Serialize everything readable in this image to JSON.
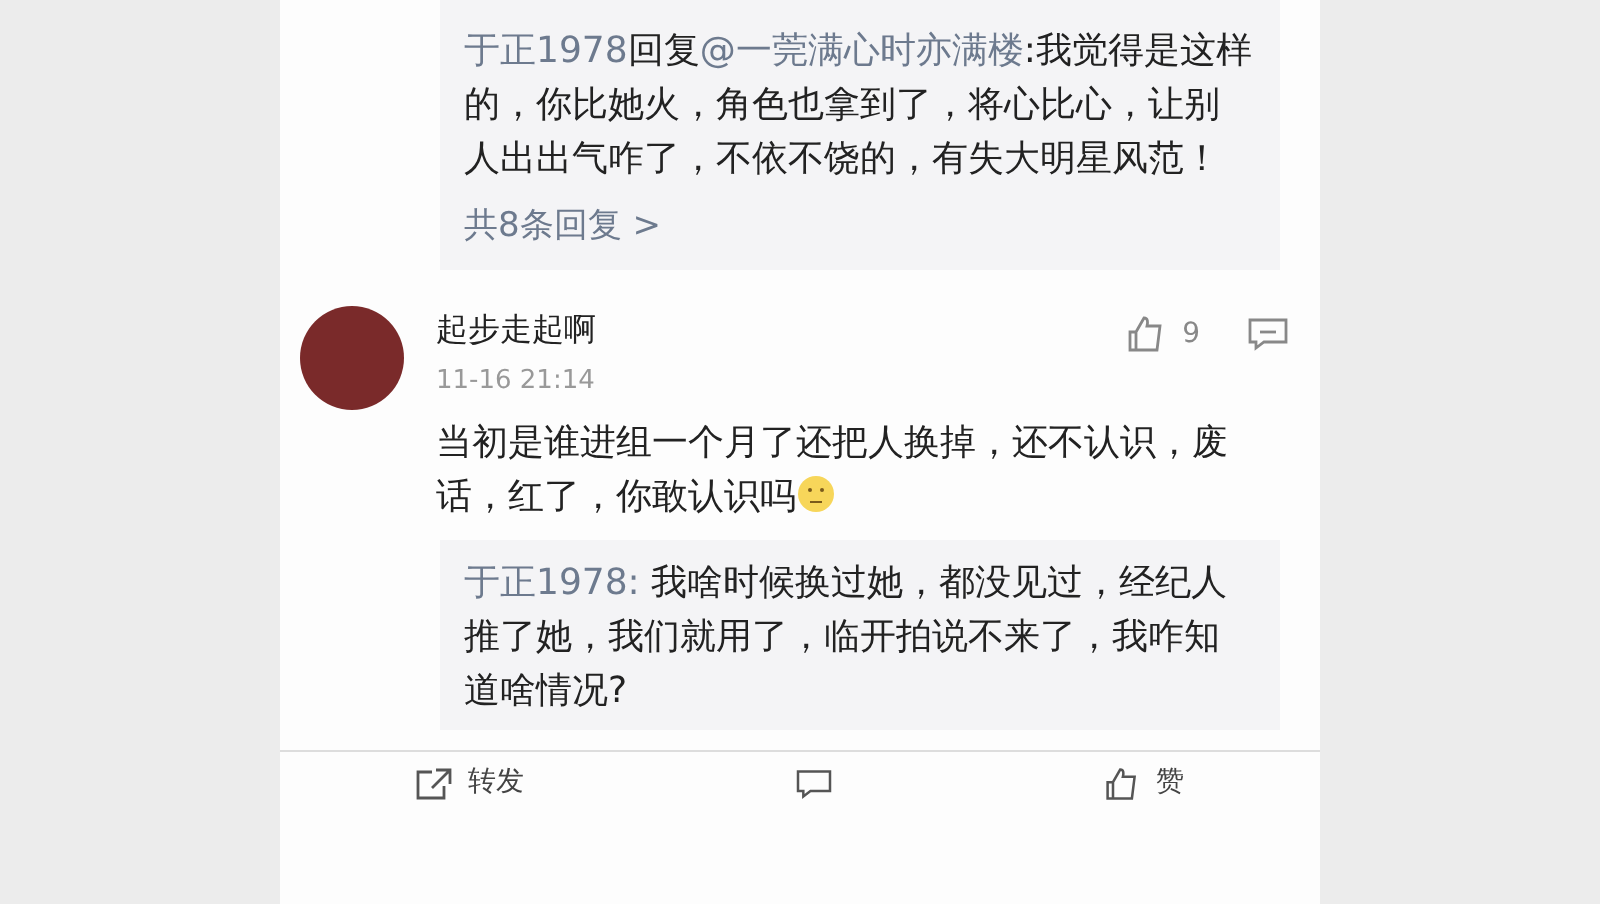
{
  "reply_preview": {
    "author": "于正1978",
    "reply_word": "回复",
    "mention": "@一莞满心时亦满楼",
    "text": ":我觉得是这样的，你比她火，角色也拿到了，将心比心，让别人出出气咋了，不依不饶的，有失大明星风范！",
    "more_replies": "共8条回复",
    "more_arrow": ">"
  },
  "comment": {
    "author": "起步走起啊",
    "time": "11-16 21:14",
    "likes": "9",
    "text": "当初是谁进组一个月了还把人换掉，还不认识，废话，红了，你敢认识吗",
    "reply": {
      "author": "于正1978:",
      "text": " 我啥时候换过她，都没见过，经纪人推了她，我们就用了，临开拍说不来了，我咋知道啥情况?"
    }
  },
  "action_bar": [
    {
      "kind": "repost",
      "label": "转发"
    },
    {
      "kind": "comment"
    },
    {
      "kind": "like",
      "label": "赞"
    }
  ]
}
